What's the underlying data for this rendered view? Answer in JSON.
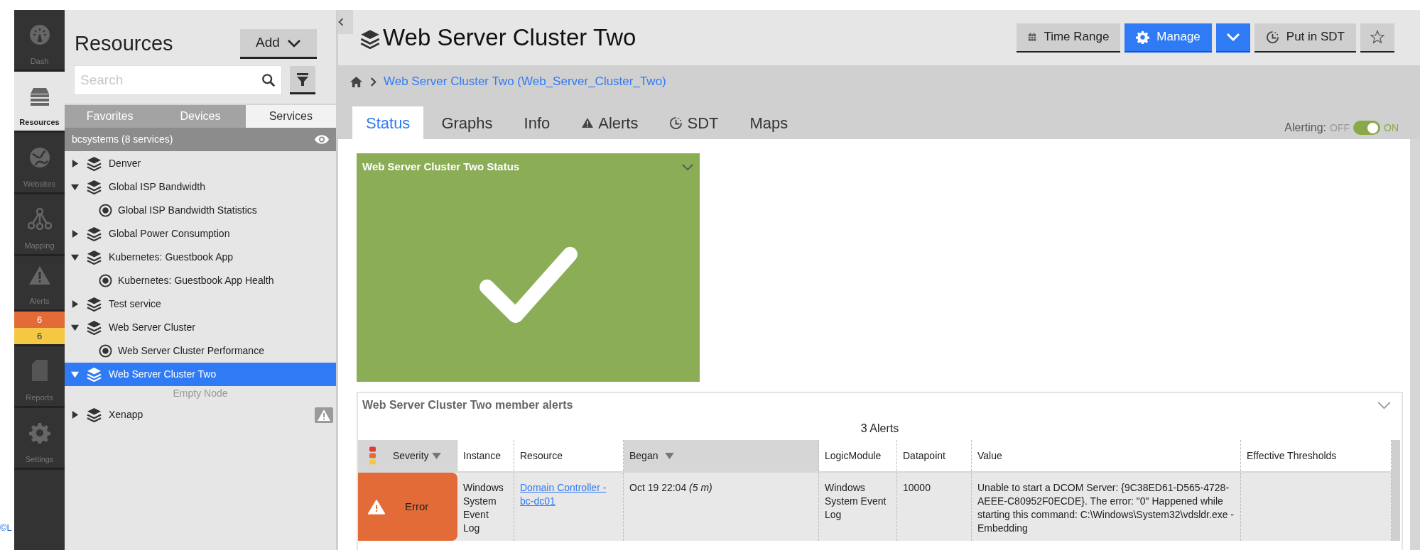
{
  "corner_text": "©L",
  "nav": {
    "items": [
      {
        "label": "Dash",
        "kind": "dash",
        "selected": false
      },
      {
        "label": "Resources",
        "kind": "resources",
        "selected": true
      },
      {
        "label": "Websites",
        "kind": "websites",
        "selected": false
      },
      {
        "label": "Mapping",
        "kind": "mapping",
        "selected": false
      },
      {
        "label": "Alerts",
        "kind": "alerts",
        "selected": false
      },
      {
        "label": "Reports",
        "kind": "reports",
        "selected": false
      },
      {
        "label": "Settings",
        "kind": "settings",
        "selected": false
      }
    ],
    "alert_counts": [
      {
        "count": "6",
        "color": "#e26b37"
      },
      {
        "count": "6",
        "color": "#f5c844"
      }
    ]
  },
  "sidebar": {
    "title": "Resources",
    "add_button": "Add",
    "search": {
      "placeholder": "Search"
    },
    "tabs": [
      {
        "label": "Favorites",
        "selected": false
      },
      {
        "label": "Devices",
        "selected": false
      },
      {
        "label": "Services",
        "selected": true
      }
    ],
    "group": "bcsystems (8 services)",
    "tree": [
      {
        "label": "Denver",
        "expanded": false,
        "selected": false,
        "warning": false
      },
      {
        "label": "Global ISP Bandwidth",
        "expanded": true,
        "selected": false,
        "warning": false,
        "children": [
          {
            "label": "Global ISP Bandwidth Statistics"
          }
        ]
      },
      {
        "label": "Global Power Consumption",
        "expanded": false,
        "selected": false,
        "warning": false
      },
      {
        "label": "Kubernetes: Guestbook App",
        "expanded": true,
        "selected": false,
        "warning": false,
        "children": [
          {
            "label": "Kubernetes: Guestbook App Health"
          }
        ]
      },
      {
        "label": "Test service",
        "expanded": false,
        "selected": false,
        "warning": false
      },
      {
        "label": "Web Server Cluster",
        "expanded": true,
        "selected": false,
        "warning": false,
        "children": [
          {
            "label": "Web Server Cluster Performance"
          }
        ]
      },
      {
        "label": "Web Server Cluster Two",
        "expanded": true,
        "selected": true,
        "warning": false,
        "empty_text": "Empty Node"
      },
      {
        "label": "Xenapp",
        "expanded": false,
        "selected": false,
        "warning": true
      }
    ]
  },
  "header": {
    "title": "Web Server Cluster Two",
    "buttons": [
      {
        "label": "Time Range",
        "kind": "calendar",
        "primary": false
      },
      {
        "label": "Manage",
        "kind": "gear",
        "primary": true
      },
      {
        "kind": "caret",
        "primary": true
      },
      {
        "label": "Put in SDT",
        "kind": "sdt",
        "primary": false
      },
      {
        "kind": "star",
        "primary": false
      }
    ]
  },
  "breadcrumb": "Web Server Cluster Two (Web_Server_Cluster_Two)",
  "tabs": [
    {
      "label": "Status",
      "kind": "plain",
      "selected": true
    },
    {
      "label": "Graphs",
      "kind": "plain",
      "selected": false
    },
    {
      "label": "Info",
      "kind": "plain",
      "selected": false
    },
    {
      "label": "Alerts",
      "kind": "alert",
      "selected": false
    },
    {
      "label": "SDT",
      "kind": "sdt",
      "selected": false
    },
    {
      "label": "Maps",
      "kind": "plain",
      "selected": false
    }
  ],
  "alerting": {
    "label": "Alerting:",
    "off": "OFF",
    "on": "ON",
    "on_state": true
  },
  "status_widget": {
    "title": "Web Server Cluster Two Status"
  },
  "alerts_widget": {
    "title": "Web Server Cluster Two member alerts",
    "count": "3 Alerts",
    "columns": [
      {
        "label": "Severity",
        "sorted": true
      },
      {
        "label": "Instance",
        "sorted": false
      },
      {
        "label": "Resource",
        "sorted": false
      },
      {
        "label": "Began",
        "sorted": true
      },
      {
        "label": "LogicModule",
        "sorted": false
      },
      {
        "label": "Datapoint",
        "sorted": false
      },
      {
        "label": "Value",
        "sorted": false
      },
      {
        "label": "Effective Thresholds",
        "sorted": false
      }
    ],
    "rows": [
      {
        "severity": "Error",
        "color": "#e26b37",
        "instance": "Windows System Event Log",
        "resource": "Domain Controller - bc-dc01",
        "began": "Oct 19 22:04 *(5 m)*",
        "logic_module": "Windows System Event Log",
        "datapoint": "10000",
        "value": "Unable to start a DCOM Server: {9C38ED61-D565-4728-AEEE-C80952F0ECDE}. The error: \"0\" Happened while starting this command: C:\\Windows\\System32\\vdsldr.exe -Embedding"
      }
    ]
  }
}
